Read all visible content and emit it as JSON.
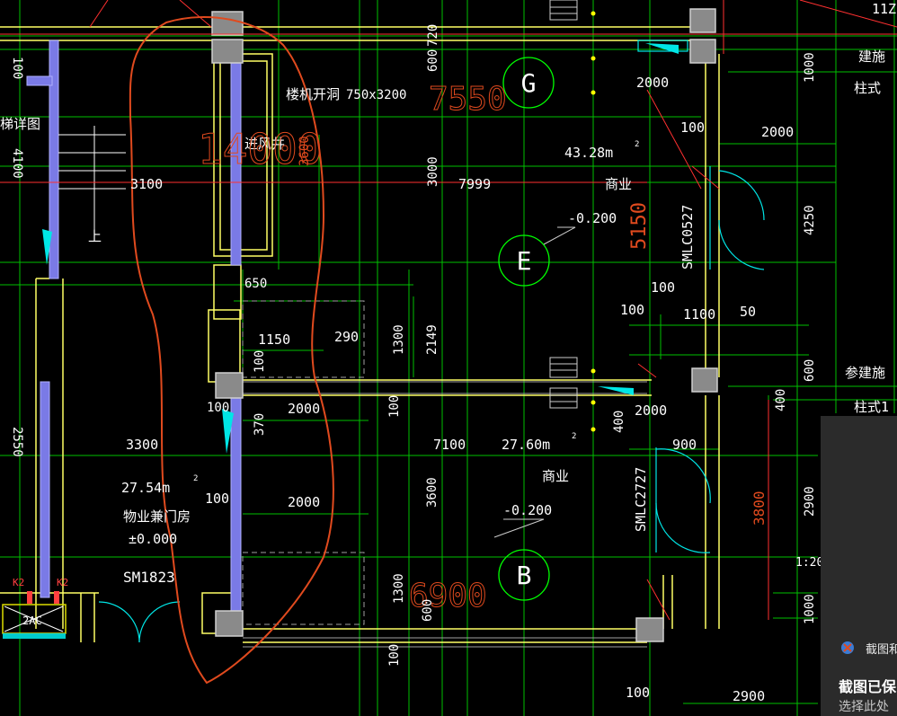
{
  "drawing": {
    "dims": {
      "d_100_top": "100",
      "d_4100": "4100",
      "d_3100": "3100",
      "d_2550": "2550",
      "d_3000": "3000",
      "d_7999": "7999",
      "d_600_a": "600",
      "d_3600_top": "3600",
      "d_650": "650",
      "d_1150": "1150",
      "d_290": "290",
      "d_1300_a": "1300",
      "d_2149": "2149",
      "d_100_b": "100",
      "d_100_c": "100",
      "d_370": "370",
      "d_2000_a": "2000",
      "d_100_d": "100",
      "d_3300": "3300",
      "d_7100": "7100",
      "d_3600": "3600",
      "d_2000_b": "2000",
      "d_100_e": "100",
      "d_1300_b": "1300",
      "d_600_b": "600",
      "d_2000_c": "2000",
      "d_100_f": "100",
      "d_2000_d": "2000",
      "d_4250": "4250",
      "d_100_g": "100",
      "d_100_h": "100",
      "d_1100": "1100",
      "d_50": "50",
      "d_600_c": "600",
      "d_400_a": "400",
      "d_2000_e": "2000",
      "d_400_b": "400",
      "d_900": "900",
      "d_2900_a": "2900",
      "d_3800": "3800",
      "d_1000": "1000",
      "d_100_i": "100",
      "d_100_j": "100",
      "d_2900_b": "2900",
      "d_1000_top": "1000",
      "d_720": "720"
    },
    "red_numbers": {
      "n_7550": "7550",
      "n_14x00": "14000",
      "n_5150": "5150",
      "n_6900": "6900"
    },
    "labels": {
      "stair_detail": "梯详图",
      "shaft_opening": "楼机开洞",
      "opening_size": "750x3200",
      "air_shaft": "进风井",
      "up": "上",
      "area_1": "43.28m",
      "sup_2a": "2",
      "commerce_1": "商业",
      "elev_1": "-0.200",
      "window_1": "SMLC0527",
      "area_2": "27.60m",
      "sup_2b": "2",
      "commerce_2": "商业",
      "elev_2": "-0.200",
      "window_2": "SMLC2727",
      "area_3": "27.54m",
      "sup_2c": "2",
      "property_room": "物业兼门房",
      "elev_3": "±0.000",
      "door_1": "SM1823",
      "k2_a": "K2",
      "k2_b": "K2",
      "ac": "2AC",
      "right_top": "11Z",
      "right_1": "建施",
      "right_2": "柱式",
      "right_3": "参建施",
      "right_4": "柱式1",
      "right_5": "1:20"
    },
    "axes": {
      "g": "G",
      "e": "E",
      "b": "B"
    }
  },
  "toast": {
    "app_title": "截图和",
    "title": "截图已保",
    "subtitle": "选择此处"
  },
  "colors": {
    "background": "#000000",
    "dimension_green": "#00ff00",
    "wall_yellow": "#ffff66",
    "column_gray": "#808080",
    "window_cyan": "#00ffff",
    "purple_wall": "#8888ff",
    "markup_red": "#e04a1e",
    "axis_red": "#ff3030",
    "text_white": "#ffffff"
  }
}
